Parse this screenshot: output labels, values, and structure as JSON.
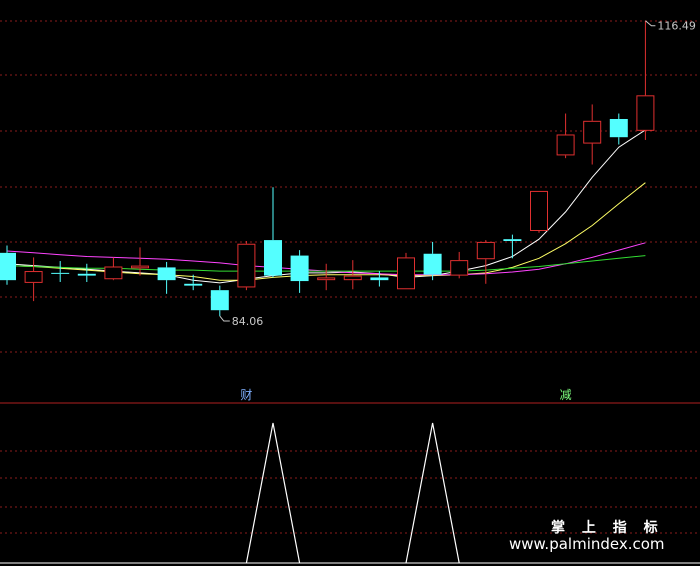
{
  "chart_data": {
    "type": "candlestick",
    "price_range": [
      80,
      118
    ],
    "high_label": "116.49",
    "low_label": "84.06",
    "colors": {
      "up": "#e03030",
      "down": "#54ffff",
      "ma5": "#ffffff",
      "ma10": "#ffff66",
      "ma20": "#ff44ff",
      "ma60": "#33dd33",
      "grid": "#8a1c1c",
      "separator": "#b02020",
      "signal": "#ffffff"
    },
    "candles": [
      {
        "o": 91.0,
        "c": 88.0,
        "h": 91.8,
        "l": 87.5
      },
      {
        "o": 87.7,
        "c": 89.0,
        "h": 90.5,
        "l": 85.7
      },
      {
        "o": 88.8,
        "c": 88.7,
        "h": 90.1,
        "l": 87.8
      },
      {
        "o": 88.7,
        "c": 88.5,
        "h": 89.8,
        "l": 87.8
      },
      {
        "o": 88.1,
        "c": 89.5,
        "h": 90.5,
        "l": 88.0
      },
      {
        "o": 89.3,
        "c": 89.6,
        "h": 91.6,
        "l": 88.5
      },
      {
        "o": 89.4,
        "c": 88.0,
        "h": 90.0,
        "l": 86.5
      },
      {
        "o": 87.6,
        "c": 87.4,
        "h": 88.6,
        "l": 86.9
      },
      {
        "o": 86.9,
        "c": 84.7,
        "h": 87.4,
        "l": 84.06
      },
      {
        "o": 87.2,
        "c": 92.0,
        "h": 92.3,
        "l": 86.9
      },
      {
        "o": 92.4,
        "c": 88.5,
        "h": 98.2,
        "l": 88.3
      },
      {
        "o": 90.7,
        "c": 87.9,
        "h": 91.3,
        "l": 86.6
      },
      {
        "o": 88.0,
        "c": 88.3,
        "h": 89.8,
        "l": 86.9
      },
      {
        "o": 88.0,
        "c": 88.5,
        "h": 90.2,
        "l": 87.0
      },
      {
        "o": 88.3,
        "c": 88.0,
        "h": 89.0,
        "l": 87.3
      },
      {
        "o": 87.0,
        "c": 90.5,
        "h": 91.0,
        "l": 87.0
      },
      {
        "o": 90.9,
        "c": 88.6,
        "h": 92.2,
        "l": 88.0
      },
      {
        "o": 88.5,
        "c": 90.2,
        "h": 91.1,
        "l": 88.2
      },
      {
        "o": 90.3,
        "c": 92.2,
        "h": 92.4,
        "l": 87.6
      },
      {
        "o": 92.5,
        "c": 92.3,
        "h": 93.0,
        "l": 90.4
      },
      {
        "o": 93.4,
        "c": 97.8,
        "h": 97.8,
        "l": 93.2
      },
      {
        "o": 101.7,
        "c": 104.0,
        "h": 106.3,
        "l": 101.4
      },
      {
        "o": 103.0,
        "c": 105.5,
        "h": 107.3,
        "l": 100.7
      },
      {
        "o": 105.7,
        "c": 103.7,
        "h": 106.3,
        "l": 102.9
      },
      {
        "o": 104.4,
        "c": 108.3,
        "h": 116.49,
        "l": 103.4
      }
    ],
    "ma": {
      "ma5": [
        89.8,
        89.6,
        89.4,
        89.2,
        89.0,
        88.8,
        88.6,
        88.0,
        87.7,
        88.1,
        88.5,
        88.8,
        88.8,
        88.9,
        88.7,
        88.3,
        88.5,
        89.0,
        89.6,
        90.6,
        92.5,
        95.5,
        99.3,
        102.6,
        104.5
      ],
      "ma10": [
        89.6,
        89.5,
        89.3,
        89.1,
        88.9,
        88.7,
        88.6,
        88.4,
        88.0,
        88.0,
        88.3,
        88.5,
        88.6,
        88.6,
        88.6,
        88.5,
        88.5,
        88.6,
        88.8,
        89.4,
        90.4,
        92.0,
        94.0,
        96.4,
        98.7
      ],
      "ma20": [
        91.2,
        91.0,
        90.8,
        90.6,
        90.5,
        90.4,
        90.3,
        90.1,
        89.9,
        89.6,
        89.4,
        89.2,
        89.0,
        88.8,
        88.7,
        88.6,
        88.6,
        88.6,
        88.7,
        88.9,
        89.2,
        89.8,
        90.5,
        91.3,
        92.1
      ],
      "ma60": [
        89.6,
        89.5,
        89.4,
        89.3,
        89.3,
        89.2,
        89.1,
        89.1,
        89.0,
        89.0,
        89.0,
        89.0,
        89.0,
        89.0,
        89.0,
        89.0,
        89.0,
        89.0,
        89.1,
        89.3,
        89.5,
        89.8,
        90.1,
        90.4,
        90.7
      ]
    },
    "markers": [
      {
        "index": 9,
        "label": "财"
      },
      {
        "index": 21,
        "label": "减"
      }
    ],
    "signal": [
      0,
      0,
      0,
      0,
      0,
      0,
      0,
      0,
      0,
      0,
      1,
      0,
      0,
      0,
      0,
      0,
      1,
      0,
      0,
      0,
      0,
      0,
      0,
      0,
      0
    ]
  },
  "watermark": {
    "line1": "掌 上 指 标",
    "line2": "www.palmindex.com"
  }
}
